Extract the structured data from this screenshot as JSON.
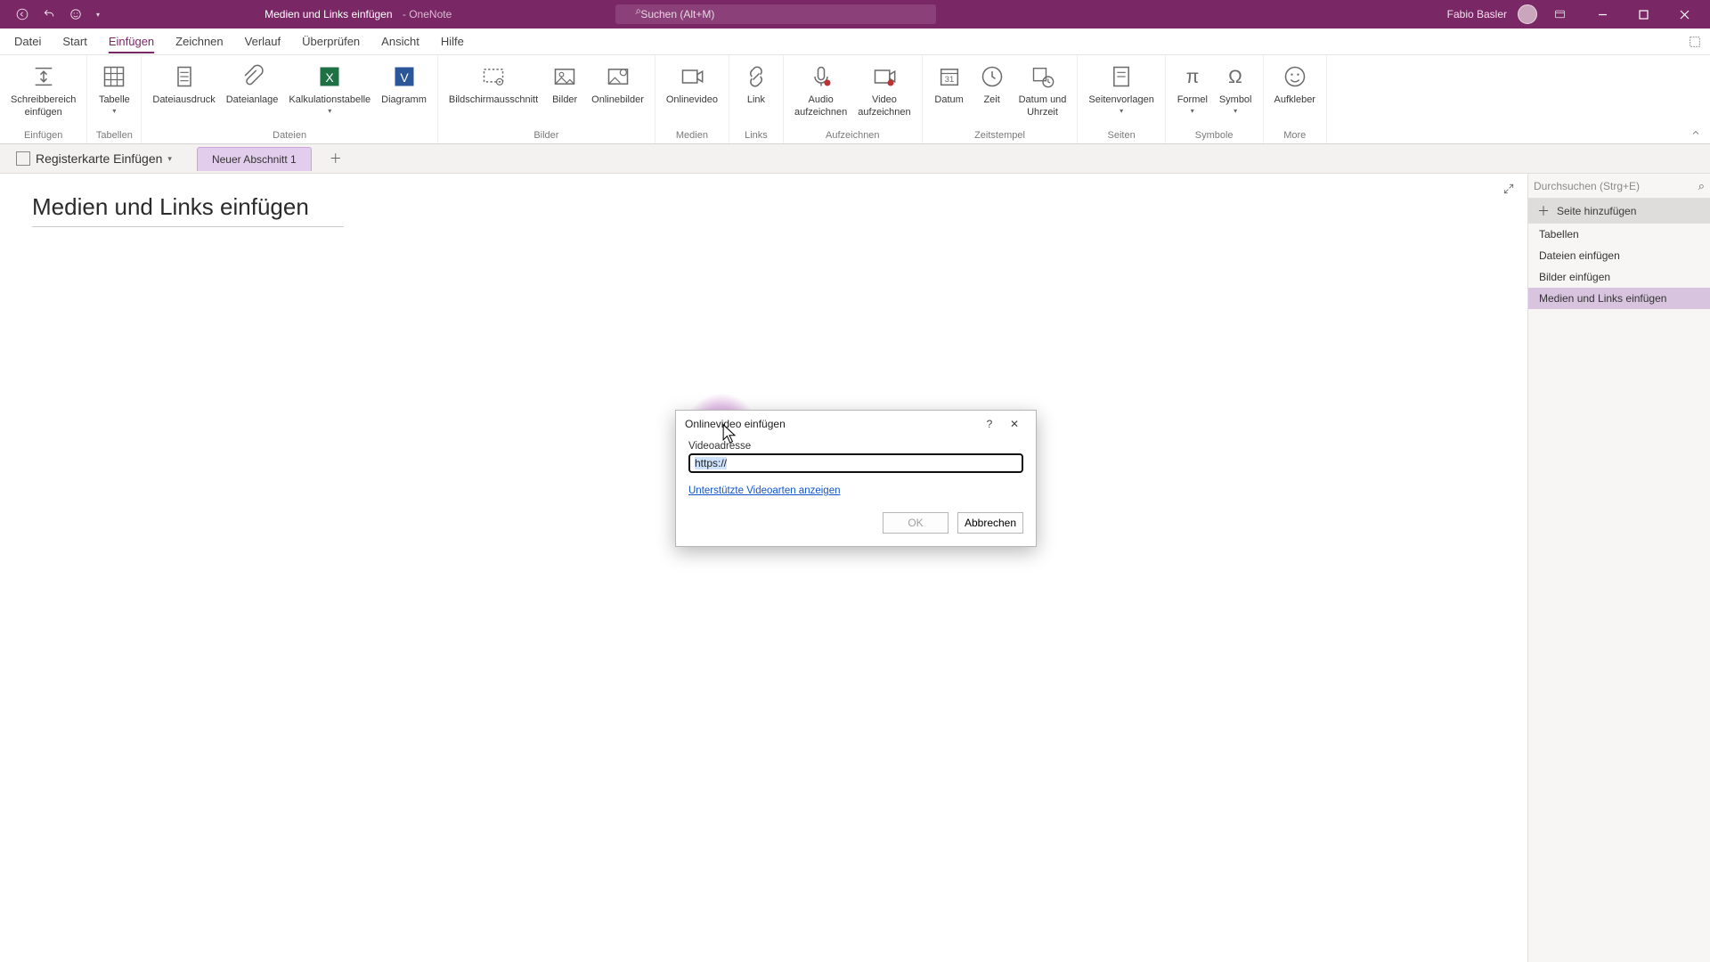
{
  "titlebar": {
    "doc_title": "Medien und Links einfügen",
    "app_name": "OneNote",
    "search_placeholder": "Suchen (Alt+M)",
    "user_name": "Fabio Basler"
  },
  "menus": {
    "items": [
      "Datei",
      "Start",
      "Einfügen",
      "Zeichnen",
      "Verlauf",
      "Überprüfen",
      "Ansicht",
      "Hilfe"
    ],
    "active_index": 2
  },
  "ribbon": {
    "groups": [
      {
        "label": "Einfügen",
        "buttons": [
          {
            "label": "Schreibbereich\neinfügen",
            "icon": "insert-space"
          }
        ]
      },
      {
        "label": "Tabellen",
        "buttons": [
          {
            "label": "Tabelle",
            "icon": "table",
            "dropdown": true
          }
        ]
      },
      {
        "label": "Dateien",
        "buttons": [
          {
            "label": "Dateiausdruck",
            "icon": "file-printout"
          },
          {
            "label": "Dateianlage",
            "icon": "attachment"
          },
          {
            "label": "Kalkulationstabelle",
            "icon": "spreadsheet",
            "dropdown": true
          },
          {
            "label": "Diagramm",
            "icon": "visio"
          }
        ]
      },
      {
        "label": "Bilder",
        "buttons": [
          {
            "label": "Bildschirmausschnitt",
            "icon": "screen-clipping"
          },
          {
            "label": "Bilder",
            "icon": "pictures"
          },
          {
            "label": "Onlinebilder",
            "icon": "online-pictures"
          }
        ]
      },
      {
        "label": "Medien",
        "buttons": [
          {
            "label": "Onlinevideo",
            "icon": "online-video"
          }
        ]
      },
      {
        "label": "Links",
        "buttons": [
          {
            "label": "Link",
            "icon": "link"
          }
        ]
      },
      {
        "label": "Aufzeichnen",
        "buttons": [
          {
            "label": "Audio\naufzeichnen",
            "icon": "record-audio"
          },
          {
            "label": "Video\naufzeichnen",
            "icon": "record-video"
          }
        ]
      },
      {
        "label": "Zeitstempel",
        "buttons": [
          {
            "label": "Datum",
            "icon": "date"
          },
          {
            "label": "Zeit",
            "icon": "time"
          },
          {
            "label": "Datum und\nUhrzeit",
            "icon": "date-time"
          }
        ]
      },
      {
        "label": "Seiten",
        "buttons": [
          {
            "label": "Seitenvorlagen",
            "icon": "page-templates",
            "dropdown": true
          }
        ]
      },
      {
        "label": "Symbole",
        "buttons": [
          {
            "label": "Formel",
            "icon": "equation",
            "dropdown": true
          },
          {
            "label": "Symbol",
            "icon": "symbol",
            "dropdown": true
          }
        ]
      },
      {
        "label": "More",
        "buttons": [
          {
            "label": "Aufkleber",
            "icon": "sticker"
          }
        ]
      }
    ]
  },
  "notebook": {
    "name": "Registerkarte Einfügen",
    "section_tab": "Neuer Abschnitt 1"
  },
  "page": {
    "title": "Medien und Links einfügen"
  },
  "pagelist": {
    "search_placeholder": "Durchsuchen (Strg+E)",
    "add_page": "Seite hinzufügen",
    "items": [
      "Tabellen",
      "Dateien einfügen",
      "Bilder einfügen",
      "Medien und Links einfügen"
    ],
    "active_index": 3
  },
  "dialog": {
    "title": "Onlinevideo einfügen",
    "field_label": "Videoadresse",
    "field_value": "https://",
    "link_text": "Unterstützte Videoarten anzeigen",
    "ok": "OK",
    "cancel": "Abbrechen"
  }
}
